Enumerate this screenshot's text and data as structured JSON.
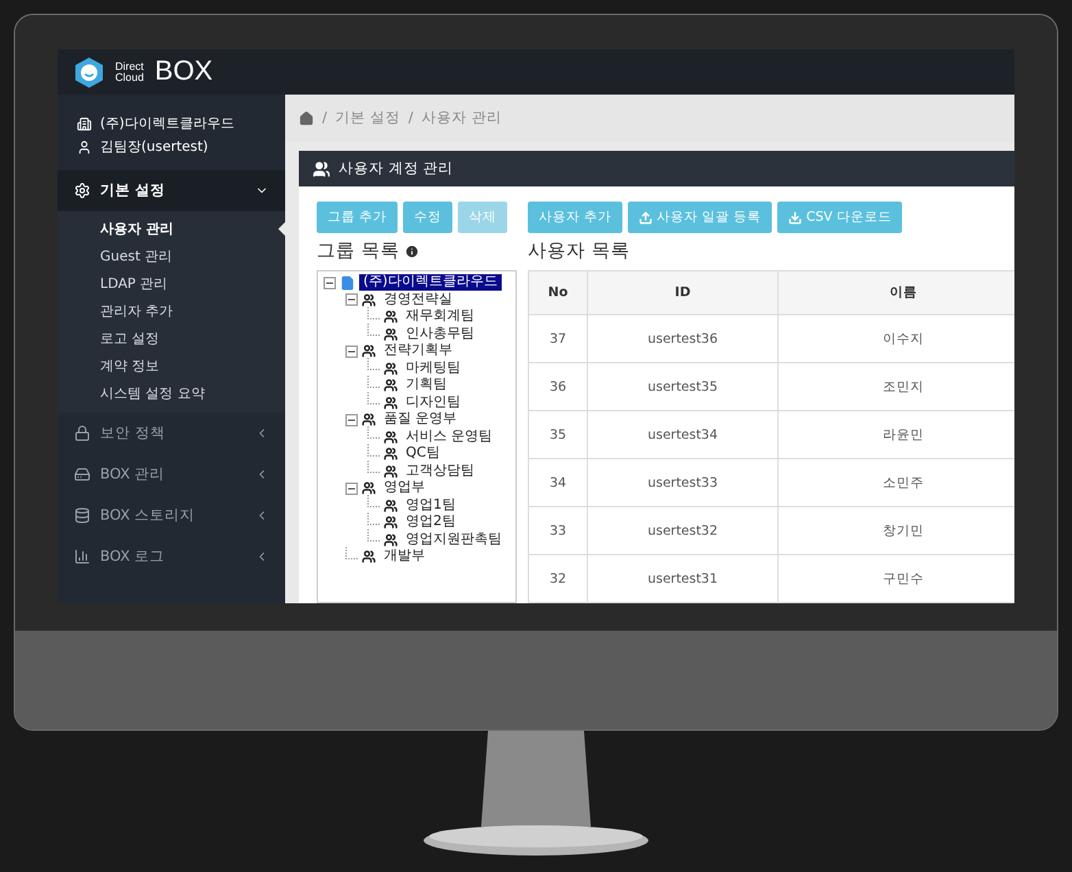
{
  "brand": {
    "line_1": "Direct",
    "line_2": "Cloud",
    "name": "BOX"
  },
  "account": {
    "company": "(주)다이렉트클라우드",
    "user": "김팀장(usertest)"
  },
  "sidebar": {
    "items": [
      {
        "kind": "settings",
        "label": "기본 설정",
        "expanded": true,
        "children": [
          {
            "label": "사용자 관리",
            "selected": true
          },
          {
            "label": "Guest 관리",
            "selected": false
          },
          {
            "label": "LDAP 관리",
            "selected": false
          },
          {
            "label": "관리자 추가",
            "selected": false
          },
          {
            "label": "로고 설정",
            "selected": false
          },
          {
            "label": "계약 정보",
            "selected": false
          },
          {
            "label": "시스템 설정 요약",
            "selected": false
          }
        ]
      },
      {
        "kind": "security",
        "label": "보안 정책",
        "expanded": false
      },
      {
        "kind": "box",
        "label": "BOX 관리",
        "expanded": false
      },
      {
        "kind": "storage",
        "label": "BOX 스토리지",
        "expanded": false
      },
      {
        "kind": "log",
        "label": "BOX 로그",
        "expanded": false
      }
    ]
  },
  "breadcrumb": {
    "separator": "/",
    "items": [
      "기본 설정",
      "사용자 관리"
    ]
  },
  "panel": {
    "title": "사용자 계정 관리"
  },
  "group_buttons": [
    {
      "label": "그룹 추가",
      "disabled": false
    },
    {
      "label": "수정",
      "disabled": false
    },
    {
      "label": "삭제",
      "disabled": true
    }
  ],
  "group_list": {
    "title": "그룹 목록",
    "tree": [
      {
        "label": "(주)다이렉트클라우드",
        "kind": "company",
        "selected": true,
        "children": [
          {
            "label": "경영전략실",
            "kind": "group",
            "selected": false,
            "children": [
              {
                "label": "재무회계팀",
                "kind": "group",
                "selected": false
              },
              {
                "label": "인사총무팀",
                "kind": "group",
                "selected": false
              }
            ]
          },
          {
            "label": "전략기획부",
            "kind": "group",
            "selected": false,
            "children": [
              {
                "label": "마케팅팀",
                "kind": "group",
                "selected": false
              },
              {
                "label": "기획팀",
                "kind": "group",
                "selected": false
              },
              {
                "label": "디자인팀",
                "kind": "group",
                "selected": false
              }
            ]
          },
          {
            "label": "품질 운영부",
            "kind": "group",
            "selected": false,
            "children": [
              {
                "label": "서비스 운영팀",
                "kind": "group",
                "selected": false
              },
              {
                "label": "QC팀",
                "kind": "group",
                "selected": false
              },
              {
                "label": "고객상담팀",
                "kind": "group",
                "selected": false
              }
            ]
          },
          {
            "label": "영업부",
            "kind": "group",
            "selected": false,
            "children": [
              {
                "label": "영업1팀",
                "kind": "group",
                "selected": false
              },
              {
                "label": "영업2팀",
                "kind": "group",
                "selected": false
              },
              {
                "label": "영업지원판촉팀",
                "kind": "group",
                "selected": false
              }
            ]
          },
          {
            "label": "개발부",
            "kind": "group",
            "selected": false
          }
        ]
      }
    ]
  },
  "user_buttons": [
    {
      "label": "사용자 추가",
      "kind": "plain"
    },
    {
      "label": "사용자 일괄 등록",
      "kind": "upload"
    },
    {
      "label": "CSV 다운로드",
      "kind": "download"
    }
  ],
  "user_list": {
    "title": "사용자 목록",
    "columns": [
      "No",
      "ID",
      "이름"
    ],
    "rows": [
      [
        "37",
        "usertest36",
        "이수지"
      ],
      [
        "36",
        "usertest35",
        "조민지"
      ],
      [
        "35",
        "usertest34",
        "라윤민"
      ],
      [
        "34",
        "usertest33",
        "소민주"
      ],
      [
        "33",
        "usertest32",
        "창기민"
      ],
      [
        "32",
        "usertest31",
        "구민수"
      ]
    ]
  }
}
